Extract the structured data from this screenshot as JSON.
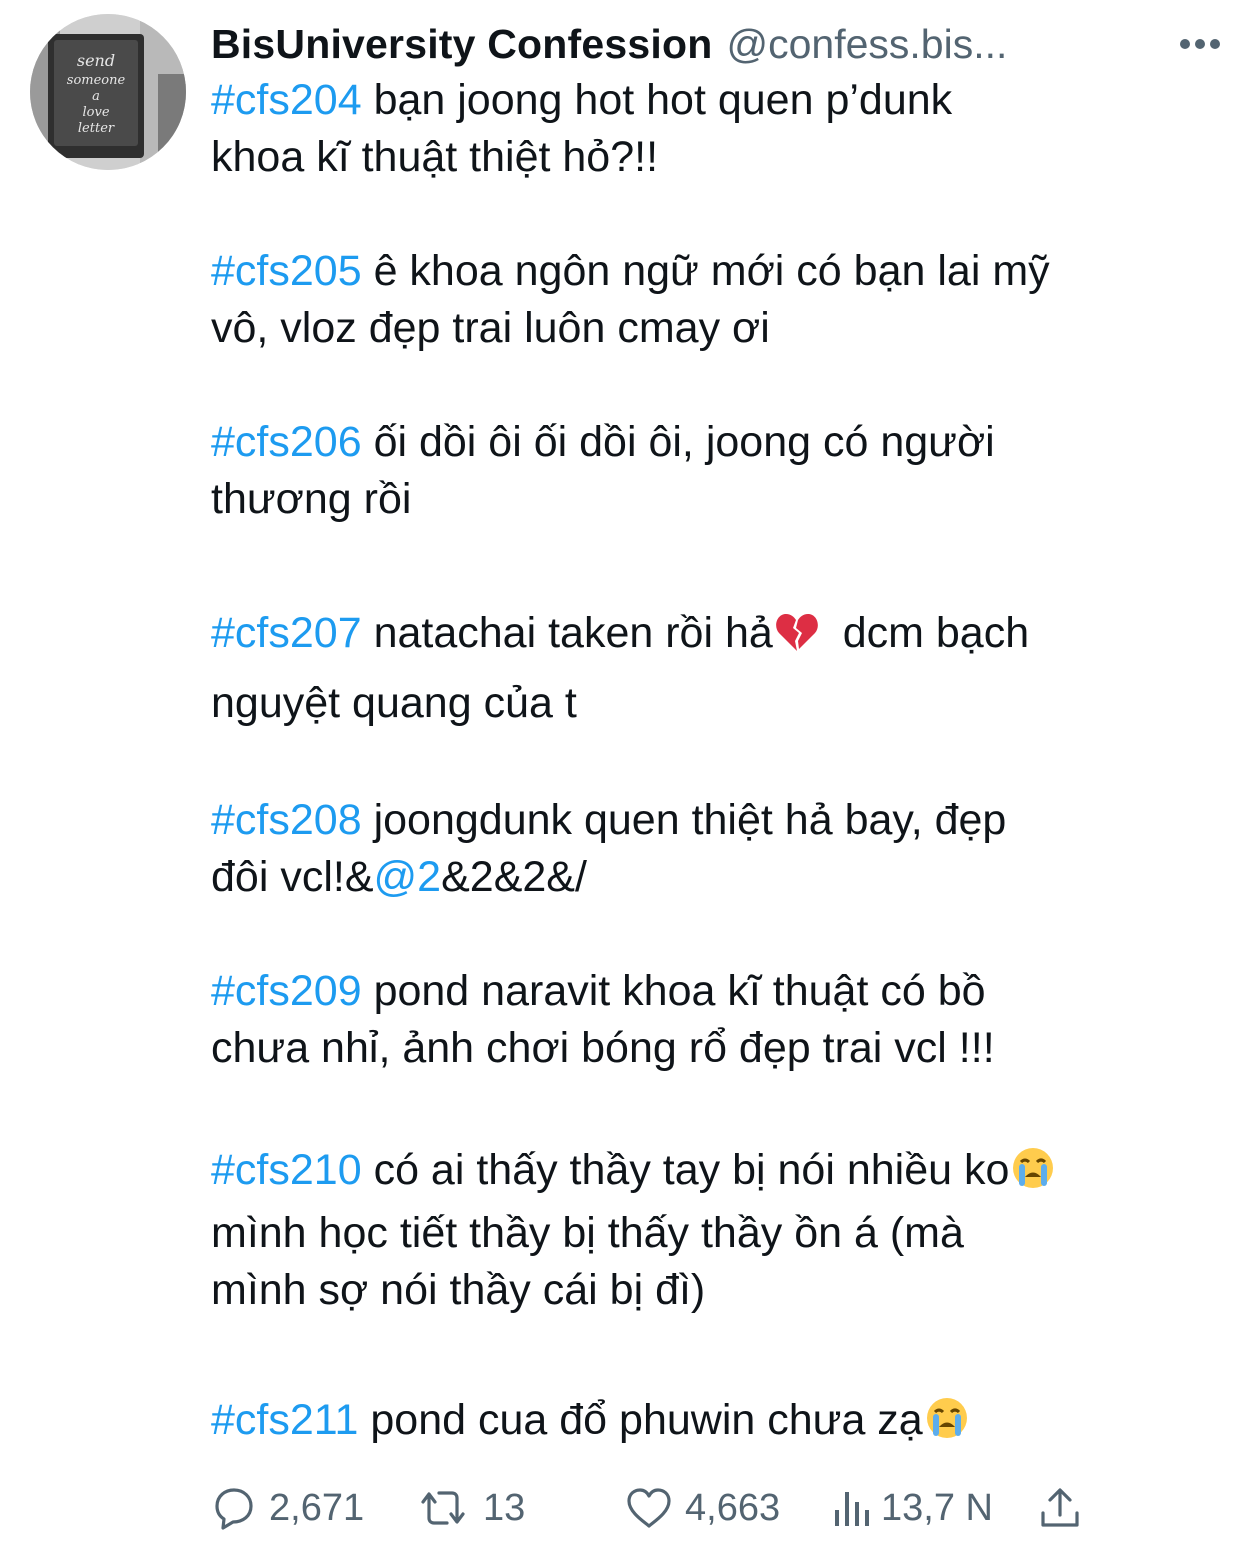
{
  "account": {
    "display_name": "BisUniversity Confession",
    "handle": "@confess.bis...",
    "avatar_icon": "love-letter-sign-avatar",
    "avatar_lines": [
      "send",
      "someone",
      "a",
      "love",
      "letter"
    ]
  },
  "more_icon": "ellipsis-icon",
  "confessions": [
    {
      "tag": "#cfs204",
      "lines": [
        "bạn joong hot hot quen p’dunk",
        "khoa kĩ thuật thiệt hỏ?!!"
      ]
    },
    {
      "tag": "#cfs205",
      "lines": [
        "ê khoa ngôn ngữ mới có bạn lai mỹ",
        "vô, vloz đẹp trai luôn cmay ơi"
      ]
    },
    {
      "tag": "#cfs206",
      "lines": [
        "ối dồi ôi ối dồi ôi, joong có người",
        "thương rồi"
      ]
    },
    {
      "tag": "#cfs207",
      "text_before_emoji": "natachai taken rồi hả",
      "emoji": "broken-heart",
      "text_after_emoji": "  dcm bạch",
      "line2": "nguyệt quang của t"
    },
    {
      "tag": "#cfs208",
      "line1": "joongdunk quen thiệt hả bay, đẹp",
      "line2_before": "đôi vcl!&",
      "mention": "@2",
      "line2_after": "&2&2&/"
    },
    {
      "tag": "#cfs209",
      "lines": [
        "pond naravit khoa kĩ thuật có bồ",
        "chưa nhỉ, ảnh chơi bóng rổ đẹp trai vcl !!!"
      ]
    },
    {
      "tag": "#cfs210",
      "line1_text": "có ai thấy thầy tay bị nói nhiều ko",
      "emoji": "loudly-crying-face",
      "line2": "mình học tiết thầy bị thấy thầy ồn á (mà",
      "line3": "mình sợ nói thầy cái bị đì)"
    },
    {
      "tag": "#cfs211",
      "text": "pond cua đổ phuwin chưa zạ",
      "emoji": "loudly-crying-face"
    }
  ],
  "actions": {
    "reply": {
      "icon": "reply-icon",
      "count": "2,671"
    },
    "retweet": {
      "icon": "retweet-icon",
      "count": "13"
    },
    "like": {
      "icon": "heart-icon",
      "count": "4,663"
    },
    "views": {
      "icon": "views-icon",
      "count": "13,7 N"
    },
    "share": {
      "icon": "share-icon"
    }
  },
  "colors": {
    "link": "#1d9bf0",
    "muted": "#536471",
    "text": "#0f1419"
  }
}
